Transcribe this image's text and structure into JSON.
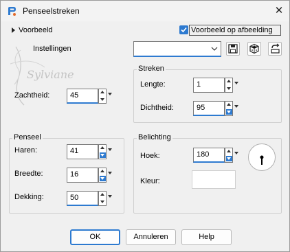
{
  "window": {
    "title": "Penseelstreken"
  },
  "top": {
    "preview_label": "Voorbeeld",
    "preview_on_image_label": "Voorbeeld op afbeelding",
    "settings_label": "Instellingen",
    "settings_value": ""
  },
  "watermark": "Sylviane",
  "softness": {
    "label": "Zachtheid:",
    "value": "45"
  },
  "strokes": {
    "title": "Streken",
    "length": {
      "label": "Lengte:",
      "value": "1"
    },
    "density": {
      "label": "Dichtheid:",
      "value": "95"
    }
  },
  "brush": {
    "title": "Penseel",
    "bristles": {
      "label": "Haren:",
      "value": "41"
    },
    "width": {
      "label": "Breedte:",
      "value": "16"
    },
    "opacity": {
      "label": "Dekking:",
      "value": "50"
    }
  },
  "lighting": {
    "title": "Belichting",
    "angle": {
      "label": "Hoek:",
      "value": "180"
    },
    "color": {
      "label": "Kleur:",
      "swatch": "#ffffff"
    }
  },
  "footer": {
    "ok": "OK",
    "cancel": "Annuleren",
    "help": "Help"
  },
  "colors": {
    "accent": "#2d7ad0",
    "app_icon": "#2d7ad0"
  }
}
